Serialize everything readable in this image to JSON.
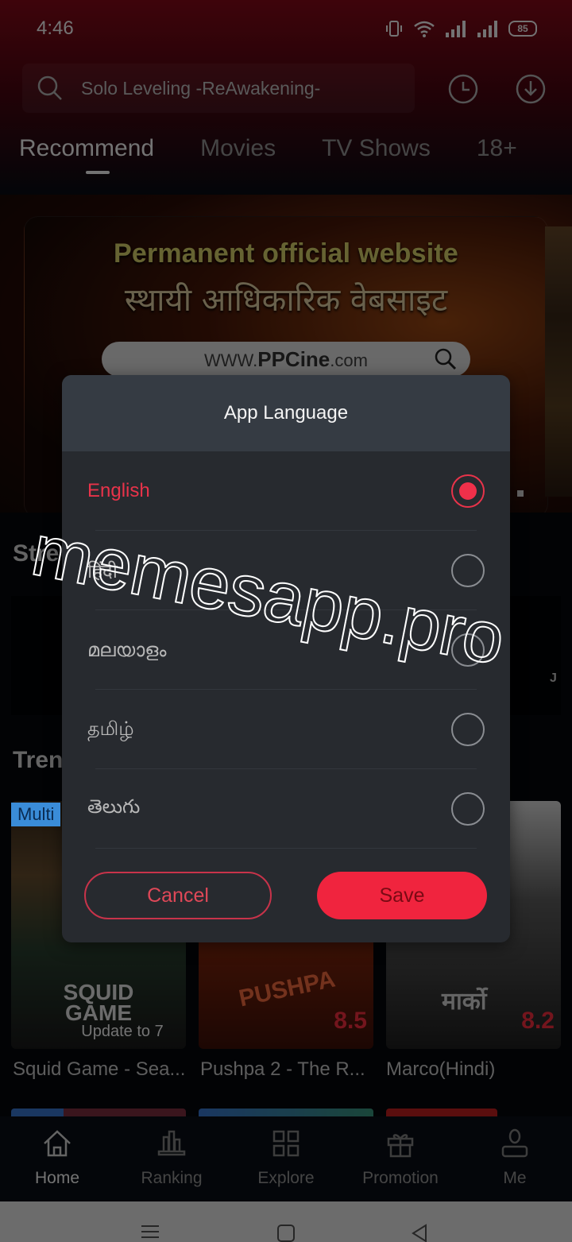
{
  "status_bar": {
    "time": "4:46",
    "battery": "85",
    "icons": [
      "vibrate-icon",
      "wifi-icon",
      "signal-icon",
      "signal-icon",
      "battery-icon"
    ]
  },
  "header": {
    "search_placeholder": "Solo Leveling -ReAwakening-",
    "history_icon": "clock-icon",
    "download_icon": "download-icon"
  },
  "tabs": [
    {
      "label": "Recommend",
      "active": true
    },
    {
      "label": "Movies",
      "active": false
    },
    {
      "label": "TV Shows",
      "active": false
    },
    {
      "label": "18+",
      "active": false
    }
  ],
  "banner": {
    "title": "Permanent official website",
    "subtitle_hindi": "स्थायी आधिकारिक वेबसाइट",
    "url_prefix": "WWW.",
    "url_brand": "PPCine",
    "url_suffix": ".com"
  },
  "sections": {
    "streaming_title": "Stre",
    "streaming_edge": "J",
    "trending_title": "Tren"
  },
  "trending": [
    {
      "badge": "Multi",
      "overlay": "Update to 7",
      "logo": "SQUID GAME",
      "caption": "Squid Game - Sea..."
    },
    {
      "logo": "PUSHPA",
      "rating": "8.5",
      "caption": "Pushpa 2 - The R..."
    },
    {
      "logo": "मार्को",
      "rating": "8.2",
      "caption": "Marco(Hindi)"
    }
  ],
  "bottom_nav": [
    {
      "label": "Home",
      "icon": "home-icon",
      "active": true
    },
    {
      "label": "Ranking",
      "icon": "ranking-icon",
      "active": false
    },
    {
      "label": "Explore",
      "icon": "grid-icon",
      "active": false
    },
    {
      "label": "Promotion",
      "icon": "gift-icon",
      "active": false
    },
    {
      "label": "Me",
      "icon": "user-icon",
      "active": false
    }
  ],
  "dialog": {
    "title": "App Language",
    "languages": [
      {
        "label": "English",
        "selected": true
      },
      {
        "label": "हिंदी",
        "selected": false
      },
      {
        "label": "മലയാളം",
        "selected": false
      },
      {
        "label": "தமிழ்",
        "selected": false
      },
      {
        "label": "తెలుగు",
        "selected": false
      }
    ],
    "cancel_label": "Cancel",
    "save_label": "Save"
  },
  "watermark": "memesapp.pro",
  "colors": {
    "accent": "#f0243e",
    "dialog_bg": "#272a2f",
    "dialog_header": "#353b43",
    "multi_badge": "#3a8cd8"
  }
}
